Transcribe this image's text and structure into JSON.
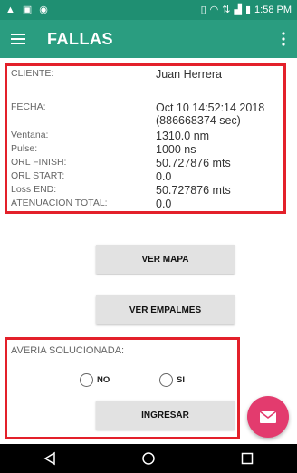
{
  "status_bar": {
    "time": "1:58 PM",
    "left_icons": [
      "warning-icon",
      "image-icon",
      "circle-app-icon"
    ],
    "right_icons": [
      "vibrate-icon",
      "wifi-icon",
      "data-icon",
      "signal-icon",
      "battery-icon"
    ]
  },
  "app_bar": {
    "title": "FALLAS",
    "menu_icon": "hamburger-menu-icon",
    "overflow_icon": "more-vertical-icon"
  },
  "info": {
    "cliente_label": "CLIENTE:",
    "cliente_value": "Juan Herrera",
    "fecha_label": "FECHA:",
    "fecha_value": "Oct 10 14:52:14 2018",
    "fecha_secs": "(886668374 sec)",
    "ventana_label": "Ventana:",
    "ventana_value": "1310.0 nm",
    "pulse_label": "Pulse:",
    "pulse_value": "1000 ns",
    "orl_finish_label": "ORL FINISH:",
    "orl_finish_value": "50.727876 mts",
    "orl_start_label": "ORL START:",
    "orl_start_value": "0.0",
    "loss_end_label": "Loss END:",
    "loss_end_value": "50.727876 mts",
    "atenuacion_label": "ATENUACION TOTAL:",
    "atenuacion_value": "0.0"
  },
  "buttons": {
    "ver_mapa": "VER MAPA",
    "ver_empalmes": "VER EMPALMES",
    "ingresar": "INGRESAR"
  },
  "averia": {
    "label": "AVERIA SOLUCIONADA:",
    "option_no": "NO",
    "option_si": "SI"
  },
  "fab": {
    "icon": "mail-icon"
  },
  "colors": {
    "status_bar": "#1f8f72",
    "app_bar": "#2a9d80",
    "highlight_border": "#e3202a",
    "fab": "#e33b6e",
    "button_bg": "#e2e2e2"
  }
}
